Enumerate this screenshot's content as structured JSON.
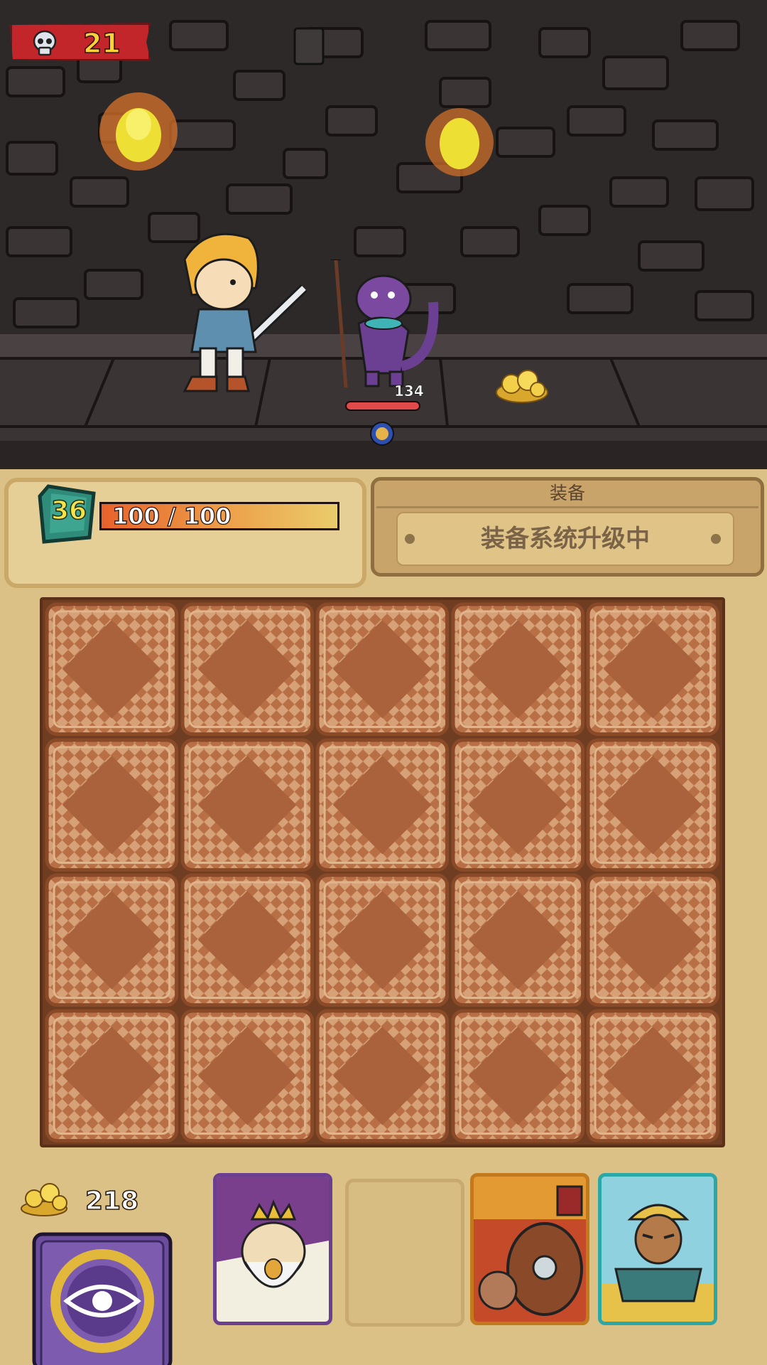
{
  "hud": {
    "kill_count": "21",
    "skull_icon": "skull-icon"
  },
  "enemy": {
    "name_icon": "purple-lizard-spearman",
    "hp_value": "134",
    "hp_fraction": 1.0
  },
  "player": {
    "level": "36",
    "hp_text": "100 / 100",
    "hp_fraction": 1.0
  },
  "equipment": {
    "title": "装备",
    "status": "装备系统升级中"
  },
  "inventory": {
    "rows": 4,
    "columns": 5,
    "filled_slots": 0
  },
  "currency": {
    "gold": "218",
    "icon": "gold-coins-icon"
  },
  "hand": {
    "deck_icon": "eye-card-deck-icon",
    "cards": [
      {
        "name": "king-card",
        "frame_color": "#6b3e8f"
      },
      {
        "name": "empty-card-slot",
        "frame_color": "#c8a96f"
      },
      {
        "name": "shield-warrior-card",
        "frame_color": "#c27a1c"
      },
      {
        "name": "scarecrow-card",
        "frame_color": "#2aa7a7"
      }
    ]
  },
  "colors": {
    "panel": "#dcc186",
    "kill_badge": "#c2262a",
    "hp_bar": "#e7622b",
    "enemy_hp": "#e04a4a"
  }
}
